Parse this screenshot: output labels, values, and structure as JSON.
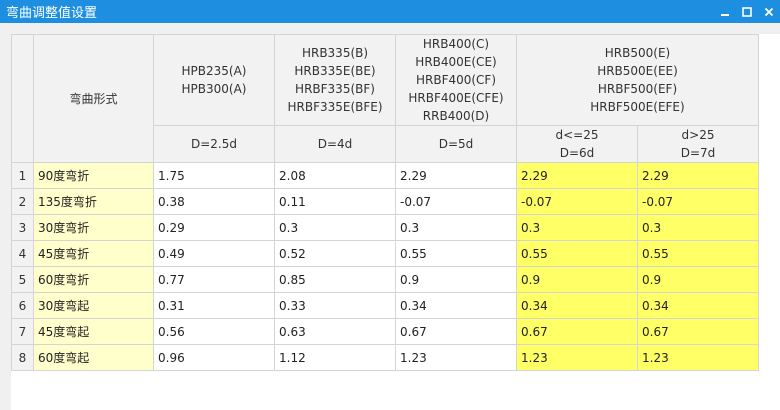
{
  "window": {
    "title": "弯曲调整值设置"
  },
  "colors": {
    "titlebar": "#1e8fe0",
    "name_cell": "#ffffcc",
    "highlight_cell": "#ffff66"
  },
  "header": {
    "name_col": "弯曲形式",
    "groups": [
      {
        "label": "HPB235(A)\nHPB300(A)",
        "sub": "D=2.5d"
      },
      {
        "label": "HRB335(B)\nHRB335E(BE)\nHRBF335(BF)\nHRBF335E(BFE)",
        "sub": "D=4d"
      },
      {
        "label": "HRB400(C)\nHRB400E(CE)\nHRBF400(CF)\nHRBF400E(CFE)\nRRB400(D)",
        "sub": "D=5d"
      },
      {
        "label": "HRB500(E)\nHRB500E(EE)\nHRBF500(EF)\nHRBF500E(EFE)",
        "subs": [
          "d<=25\nD=6d",
          "d>25\nD=7d"
        ]
      }
    ]
  },
  "rows": [
    {
      "num": "1",
      "name": "90度弯折",
      "values": [
        "1.75",
        "2.08",
        "2.29",
        "2.29",
        "2.29"
      ]
    },
    {
      "num": "2",
      "name": "135度弯折",
      "values": [
        "0.38",
        "0.11",
        "-0.07",
        "-0.07",
        "-0.07"
      ]
    },
    {
      "num": "3",
      "name": "30度弯折",
      "values": [
        "0.29",
        "0.3",
        "0.3",
        "0.3",
        "0.3"
      ]
    },
    {
      "num": "4",
      "name": "45度弯折",
      "values": [
        "0.49",
        "0.52",
        "0.55",
        "0.55",
        "0.55"
      ]
    },
    {
      "num": "5",
      "name": "60度弯折",
      "values": [
        "0.77",
        "0.85",
        "0.9",
        "0.9",
        "0.9"
      ]
    },
    {
      "num": "6",
      "name": "30度弯起",
      "values": [
        "0.31",
        "0.33",
        "0.34",
        "0.34",
        "0.34"
      ]
    },
    {
      "num": "7",
      "name": "45度弯起",
      "values": [
        "0.56",
        "0.63",
        "0.67",
        "0.67",
        "0.67"
      ]
    },
    {
      "num": "8",
      "name": "60度弯起",
      "values": [
        "0.96",
        "1.12",
        "1.23",
        "1.23",
        "1.23"
      ]
    }
  ]
}
